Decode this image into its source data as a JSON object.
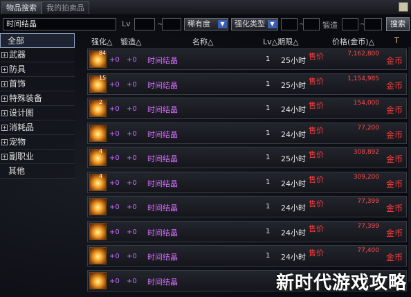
{
  "tabs": [
    {
      "label": "物品搜索"
    },
    {
      "label": "我的拍卖品"
    }
  ],
  "filter": {
    "search_value": "时间结晶",
    "lv_label": "Lv",
    "rarity_label": "稀有度",
    "upgrade_type_label": "强化类型",
    "forge_label": "锻造",
    "search_button": "搜索"
  },
  "categories": [
    {
      "label": "全部"
    },
    {
      "label": "武器"
    },
    {
      "label": "防具"
    },
    {
      "label": "首饰"
    },
    {
      "label": "特殊装备"
    },
    {
      "label": "设计图"
    },
    {
      "label": "消耗品"
    },
    {
      "label": "宠物"
    },
    {
      "label": "副职业"
    },
    {
      "label": "其他"
    }
  ],
  "columns": {
    "upgrade": "强化△",
    "forge": "锻造△",
    "name": "名称△",
    "lv_duration": "Lv△期限△",
    "price": "价格(金币)△"
  },
  "rows": [
    {
      "qty": "84",
      "upgrade": "+0",
      "forge": "+0",
      "name": "时间结晶",
      "lv": "1",
      "duration": "25小时",
      "sell": "售价",
      "price": "7,162,800",
      "currency": "金币"
    },
    {
      "qty": "15",
      "upgrade": "+0",
      "forge": "+0",
      "name": "时间结晶",
      "lv": "1",
      "duration": "25小时",
      "sell": "售价",
      "price": "1,154,985",
      "currency": "金币"
    },
    {
      "qty": "2",
      "upgrade": "+0",
      "forge": "+0",
      "name": "时间结晶",
      "lv": "1",
      "duration": "24小时",
      "sell": "售价",
      "price": "154,000",
      "currency": "金币"
    },
    {
      "qty": "",
      "upgrade": "+0",
      "forge": "+0",
      "name": "时间结晶",
      "lv": "1",
      "duration": "24小时",
      "sell": "售价",
      "price": "77,200",
      "currency": "金币"
    },
    {
      "qty": "4",
      "upgrade": "+0",
      "forge": "+0",
      "name": "时间结晶",
      "lv": "1",
      "duration": "25小时",
      "sell": "售价",
      "price": "308,892",
      "currency": "金币"
    },
    {
      "qty": "4",
      "upgrade": "+0",
      "forge": "+0",
      "name": "时间结晶",
      "lv": "1",
      "duration": "24小时",
      "sell": "售价",
      "price": "309,200",
      "currency": "金币"
    },
    {
      "qty": "",
      "upgrade": "+0",
      "forge": "+0",
      "name": "时间结晶",
      "lv": "1",
      "duration": "24小时",
      "sell": "售价",
      "price": "77,399",
      "currency": "金币"
    },
    {
      "qty": "",
      "upgrade": "+0",
      "forge": "+0",
      "name": "时间结晶",
      "lv": "1",
      "duration": "24小时",
      "sell": "售价",
      "price": "77,399",
      "currency": "金币"
    },
    {
      "qty": "",
      "upgrade": "+0",
      "forge": "+0",
      "name": "时间结晶",
      "lv": "1",
      "duration": "24小时",
      "sell": "售价",
      "price": "77,400",
      "currency": "金币"
    },
    {
      "qty": "",
      "upgrade": "+0",
      "forge": "+0",
      "name": "时间结晶",
      "lv": "",
      "duration": "",
      "sell": "",
      "price": "",
      "currency": ""
    }
  ],
  "watermark": "新时代游戏攻略",
  "icons": {
    "item": "time-crystal-icon",
    "corner": "window-icon",
    "sort": "hammer-icon"
  }
}
